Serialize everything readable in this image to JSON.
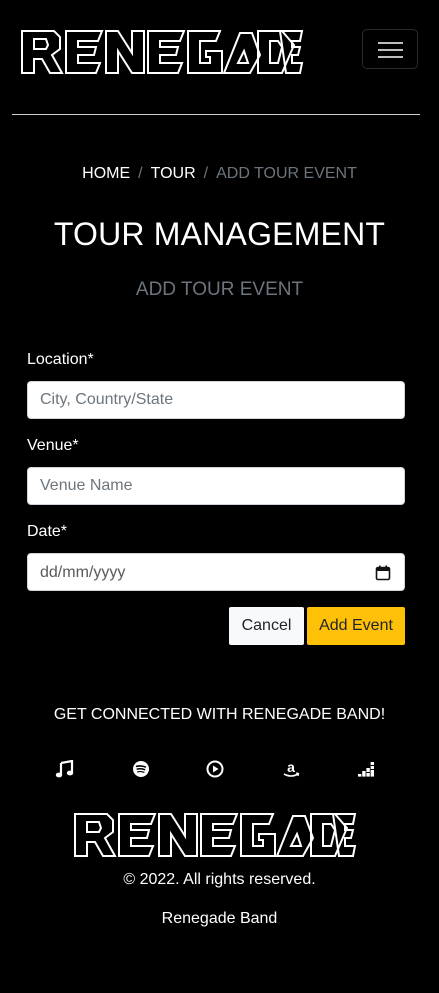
{
  "brand": {
    "logo_text": "RENEGADE"
  },
  "breadcrumb": {
    "home": "HOME",
    "tour": "TOUR",
    "current": "ADD TOUR EVENT",
    "separator": "/"
  },
  "header": {
    "title": "TOUR MANAGEMENT",
    "subtitle": "ADD TOUR EVENT"
  },
  "form": {
    "location": {
      "label": "Location*",
      "placeholder": "City, Country/State",
      "value": ""
    },
    "venue": {
      "label": "Venue*",
      "placeholder": "Venue Name",
      "value": ""
    },
    "date": {
      "label": "Date*",
      "placeholder": "dd/mm/yyyy",
      "value": ""
    },
    "cancel_label": "Cancel",
    "submit_label": "Add Event"
  },
  "footer": {
    "connect_text": "GET CONNECTED WITH RENEGADE BAND!",
    "social_icons": [
      "music-note-icon",
      "spotify-icon",
      "play-circle-icon",
      "amazon-icon",
      "deezer-icon"
    ],
    "copyright": "© 2022. All rights reserved.",
    "band_name": "Renegade Band"
  },
  "colors": {
    "background": "#000000",
    "accent": "#ffc107",
    "muted": "#6c757d",
    "text": "#ffffff"
  }
}
